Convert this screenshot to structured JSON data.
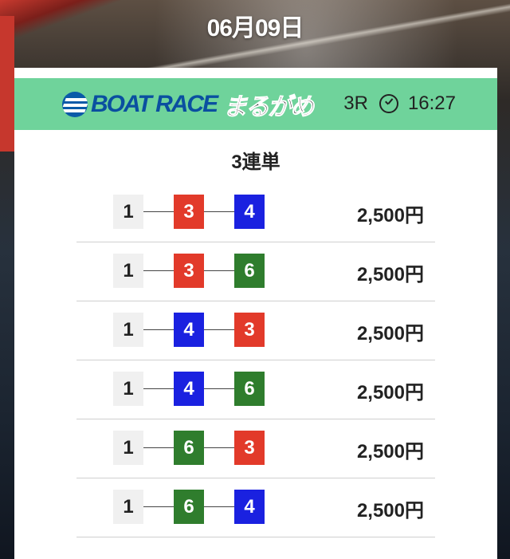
{
  "date": "06月09日",
  "header": {
    "logo_text": "BOAT RACE",
    "venue": "まるがめ",
    "race": "3R",
    "time": "16:27",
    "accent_color": "#6fd39b"
  },
  "bet_type": "3連単",
  "colors": {
    "1": "#f0f0f0",
    "3": "#e23a2a",
    "4": "#1a21e0",
    "6": "#2f7d2d"
  },
  "results": [
    {
      "combo": [
        "1",
        "3",
        "4"
      ],
      "payout": "2,500円"
    },
    {
      "combo": [
        "1",
        "3",
        "6"
      ],
      "payout": "2,500円"
    },
    {
      "combo": [
        "1",
        "4",
        "3"
      ],
      "payout": "2,500円"
    },
    {
      "combo": [
        "1",
        "4",
        "6"
      ],
      "payout": "2,500円"
    },
    {
      "combo": [
        "1",
        "6",
        "3"
      ],
      "payout": "2,500円"
    },
    {
      "combo": [
        "1",
        "6",
        "4"
      ],
      "payout": "2,500円"
    }
  ]
}
